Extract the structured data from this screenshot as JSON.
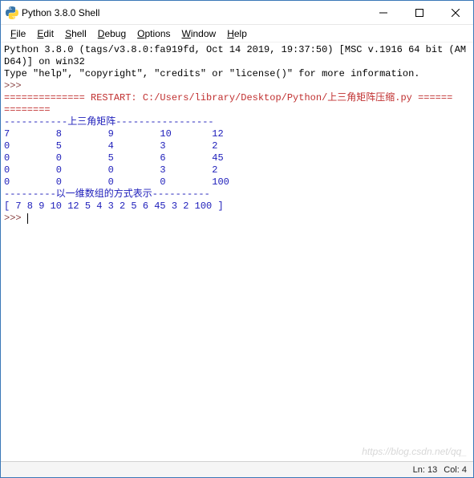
{
  "window": {
    "title": "Python 3.8.0 Shell"
  },
  "menu": {
    "file": "File",
    "edit": "Edit",
    "shell": "Shell",
    "debug": "Debug",
    "options": "Options",
    "window": "Window",
    "help": "Help"
  },
  "shell": {
    "banner_line1": "Python 3.8.0 (tags/v3.8.0:fa919fd, Oct 14 2019, 19:37:50) [MSC v.1916 64 bit (AM",
    "banner_line2": "D64)] on win32",
    "banner_line3": "Type \"help\", \"copyright\", \"credits\" or \"license()\" for more information.",
    "prompt1": ">>> ",
    "restart": "============== RESTART: C:/Users/library/Desktop/Python/上三角矩阵压缩.py ======\n========",
    "out_header1": "-----------上三角矩阵-----------------",
    "matrix_row0": "7        8        9        10       12",
    "matrix_row1": "0        5        4        3        2",
    "matrix_row2": "0        0        5        6        45",
    "matrix_row3": "0        0        0        3        2",
    "matrix_row4": "0        0        0        0        100",
    "out_header2": "---------以一维数组的方式表示----------",
    "array_line": "[ 7 8 9 10 12 5 4 3 2 5 6 45 3 2 100 ]",
    "prompt2": ">>> "
  },
  "status": {
    "line": "Ln: 13",
    "col": "Col: 4"
  },
  "watermark": "https://blog.csdn.net/qq_"
}
